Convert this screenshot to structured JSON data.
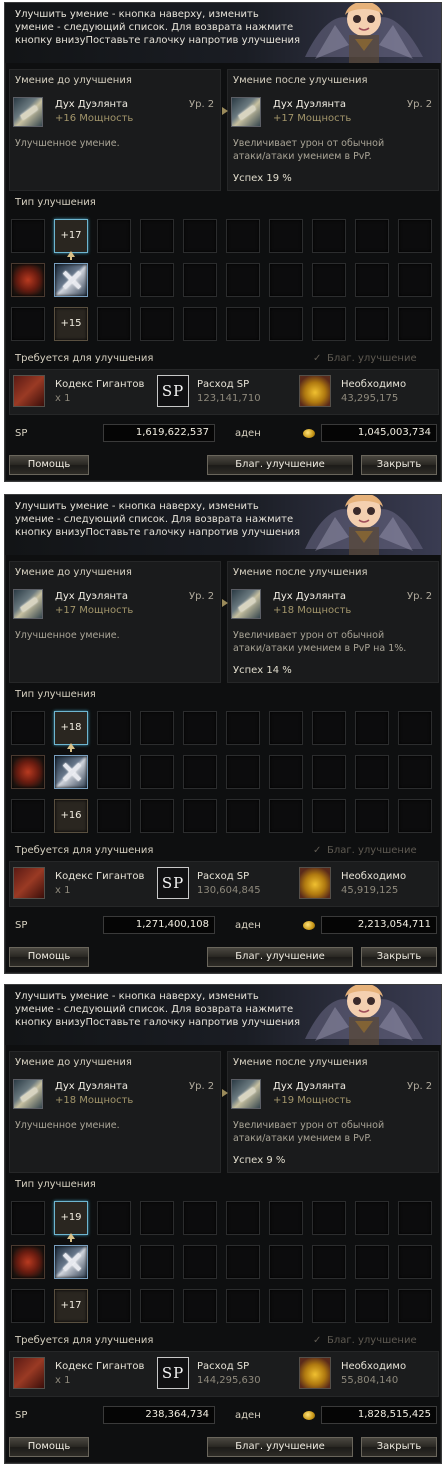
{
  "common": {
    "header_line1": "Улучшить умение - кнопка наверху, изменить",
    "header_line2": "умение - следующий список. Для возврата нажмите",
    "header_line3": "кнопку внизуПоставьте галочку напротив улучшения",
    "before_title": "Умение до улучшения",
    "after_title": "Умение после улучшения",
    "skill_name": "Дух Дуэлянта",
    "skill_level": "Ур. 2",
    "before_desc": "Улучшенное умение.",
    "type_title": "Тип улучшения",
    "required_title": "Требуется для улучшения",
    "check_label": "Благ. улучшение",
    "check_mark": "✓",
    "req_book_name": "Кодекс Гигантов",
    "req_book_qty": "x 1",
    "req_sp_name": "Расход SP",
    "req_sp_icon": "SP",
    "req_adena_name": "Необходимо",
    "sp_label": "SP",
    "adena_label": "аден",
    "help_button": "Помощь",
    "bless_button": "Благ. улучшение",
    "close_button": "Закрыть"
  },
  "windows": [
    {
      "before_power": "+16 Мощность",
      "after_power": "+17 Мощность",
      "after_desc_1": "Увеличивает урон от обычной",
      "after_desc_2": "атаки/атаки умением в PvP.",
      "success": "Успех 19 %",
      "option_top": "+17",
      "option_bottom": "+15",
      "sp_cost": "123,141,710",
      "adena_cost": "43,295,175",
      "sp_have": "1,619,622,537",
      "adena_have": "1,045,003,734"
    },
    {
      "before_power": "+17 Мощность",
      "after_power": "+18 Мощность",
      "after_desc_1": "Увеличивает урон от обычной",
      "after_desc_2": "атаки/атаки умением в PvP на 1%.",
      "success": "Успех 14 %",
      "option_top": "+18",
      "option_bottom": "+16",
      "sp_cost": "130,604,845",
      "adena_cost": "45,919,125",
      "sp_have": "1,271,400,108",
      "adena_have": "2,213,054,711"
    },
    {
      "before_power": "+18 Мощность",
      "after_power": "+19 Мощность",
      "after_desc_1": "Увеличивает урон от обычной",
      "after_desc_2": "атаки/атаки умением в PvP.",
      "success": "Успех 9 %",
      "option_top": "+19",
      "option_bottom": "+17",
      "sp_cost": "144,295,630",
      "adena_cost": "55,804,140",
      "sp_have": "238,364,734",
      "adena_have": "1,828,515,425"
    }
  ],
  "colors": {
    "panel_bg": "#0e0f10",
    "section_bg": "#1a1b1c",
    "power_text": "#a3966b",
    "selected_border": "#6fb6d0"
  },
  "icons": [
    "angel-mascot-icon",
    "skill-sword-icon",
    "arrow-right-icon",
    "whip-icon",
    "book-icon",
    "sp-icon",
    "gold-pile-icon",
    "coin-icon",
    "checkmark-icon"
  ]
}
